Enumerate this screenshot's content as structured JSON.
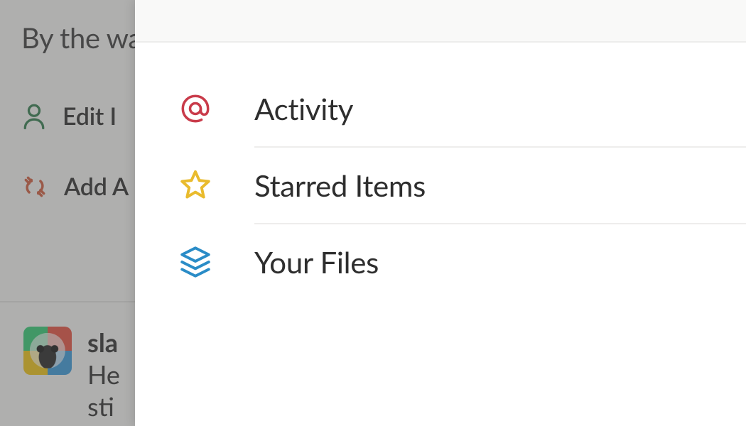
{
  "underlay": {
    "intro_text": "By the way, you're not the only one who signed up today — here are some people you might like to chat with! Here ar",
    "edit_label": "Edit I",
    "add_label": "Add A",
    "message": {
      "sender": "sla",
      "line1": "He",
      "line2": "sti"
    }
  },
  "panel": {
    "items": [
      {
        "label": "Activity"
      },
      {
        "label": "Starred Items"
      },
      {
        "label": "Your Files"
      }
    ]
  }
}
